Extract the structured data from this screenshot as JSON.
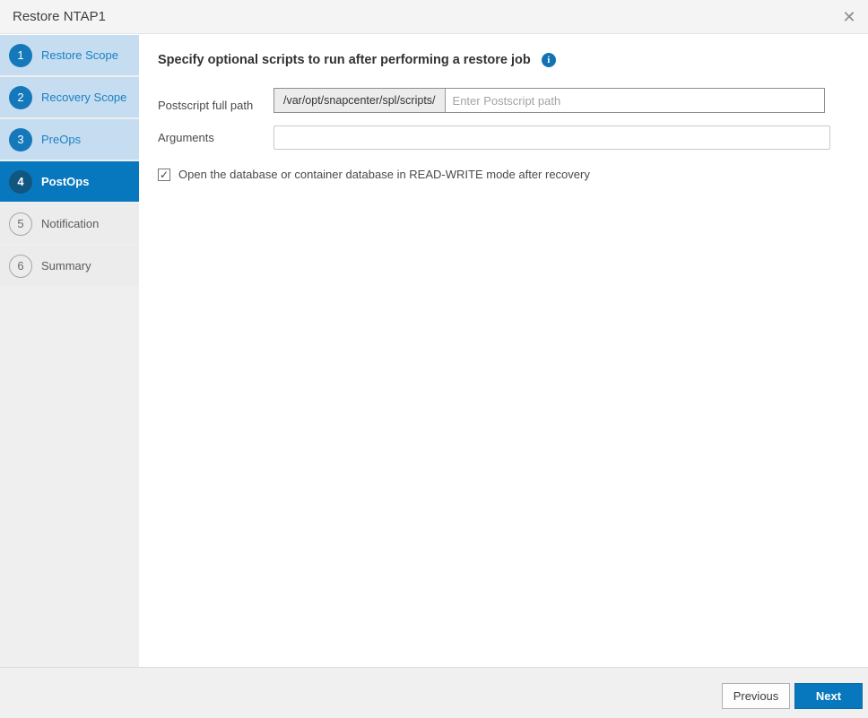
{
  "window": {
    "title": "Restore NTAP1"
  },
  "icons": {
    "close": "✕",
    "info": "i",
    "check": "✓"
  },
  "colors": {
    "accent_blue": "#0878be",
    "active_step_bg": "#0878be",
    "active_step_circle": "#10567f",
    "done_step_bg": "#c6dcf0",
    "done_step_circle": "#1578ba",
    "done_step_text": "#1982c5",
    "todo_step_bg": "#ececec",
    "sidebar_bg": "#efefef",
    "header_bg": "#f4f4f4",
    "footer_bg": "#f0f0f0"
  },
  "steps": [
    {
      "num": "1",
      "label": "Restore Scope",
      "state": "done"
    },
    {
      "num": "2",
      "label": "Recovery Scope",
      "state": "done"
    },
    {
      "num": "3",
      "label": "PreOps",
      "state": "done"
    },
    {
      "num": "4",
      "label": "PostOps",
      "state": "active"
    },
    {
      "num": "5",
      "label": "Notification",
      "state": "todo"
    },
    {
      "num": "6",
      "label": "Summary",
      "state": "todo"
    }
  ],
  "main": {
    "heading": "Specify optional scripts to run after performing a restore job",
    "postscript_label": "Postscript full path",
    "postscript_prefix": "/var/opt/snapcenter/spl/scripts/",
    "postscript_placeholder": "Enter Postscript path",
    "postscript_value": "",
    "arguments_label": "Arguments",
    "arguments_value": "",
    "checkbox_checked": true,
    "checkbox_label": "Open the database or container database in READ-WRITE mode after recovery"
  },
  "footer": {
    "previous": "Previous",
    "next": "Next"
  }
}
